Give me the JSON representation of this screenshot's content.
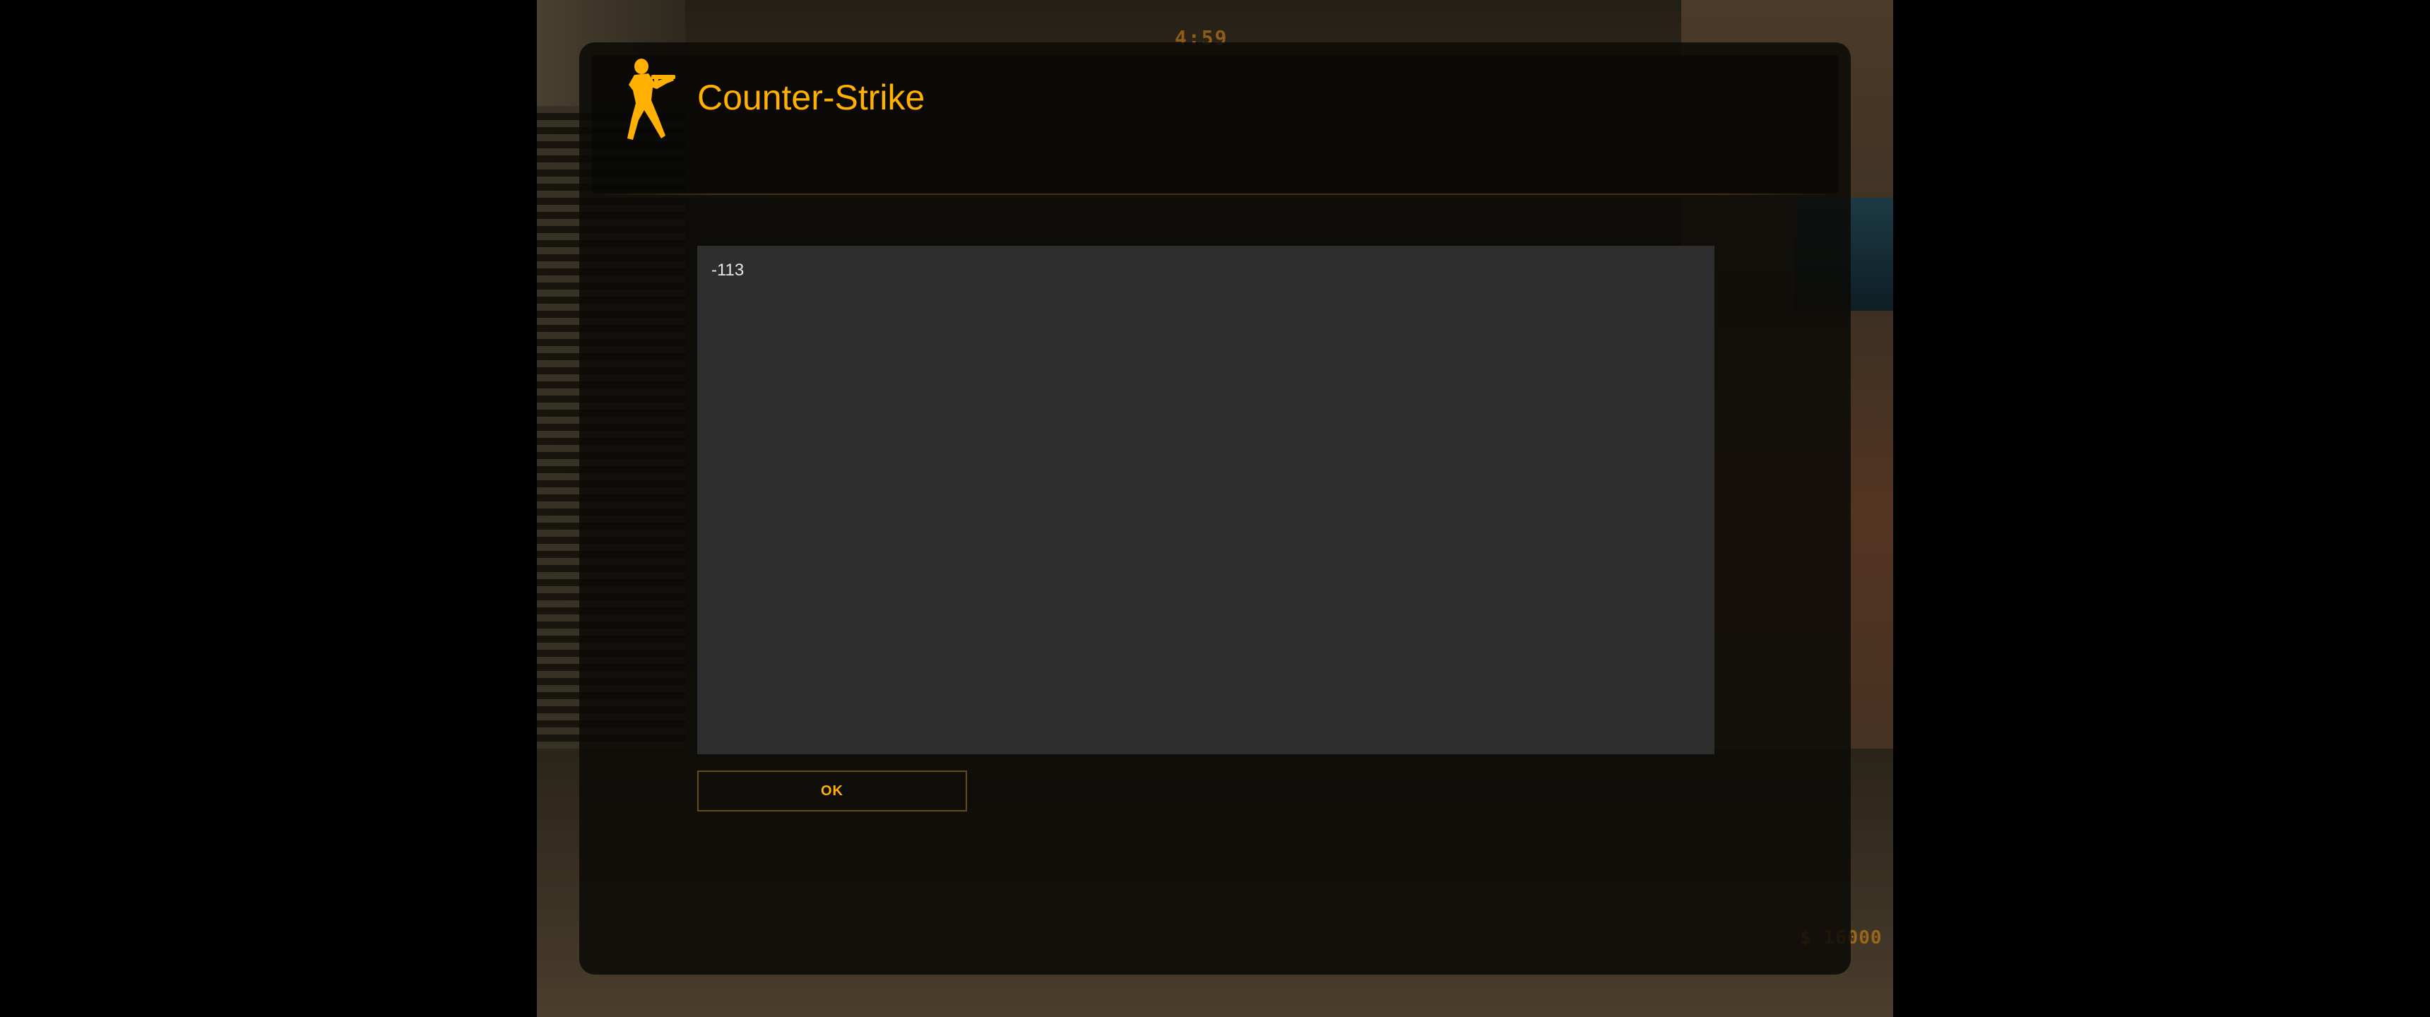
{
  "hud": {
    "round_timer": "4:59",
    "money": "$ 16000"
  },
  "dialog": {
    "title": "Counter-Strike",
    "logo_icon": "counter-strike-logo-icon",
    "message": "-113",
    "ok_label": "OK"
  },
  "colors": {
    "accent": "#FFB000",
    "dialog_bg": "#0C0A07",
    "message_bg": "#2E2E2E",
    "message_text": "#E6E6E6",
    "button_border": "#6B4A10"
  }
}
